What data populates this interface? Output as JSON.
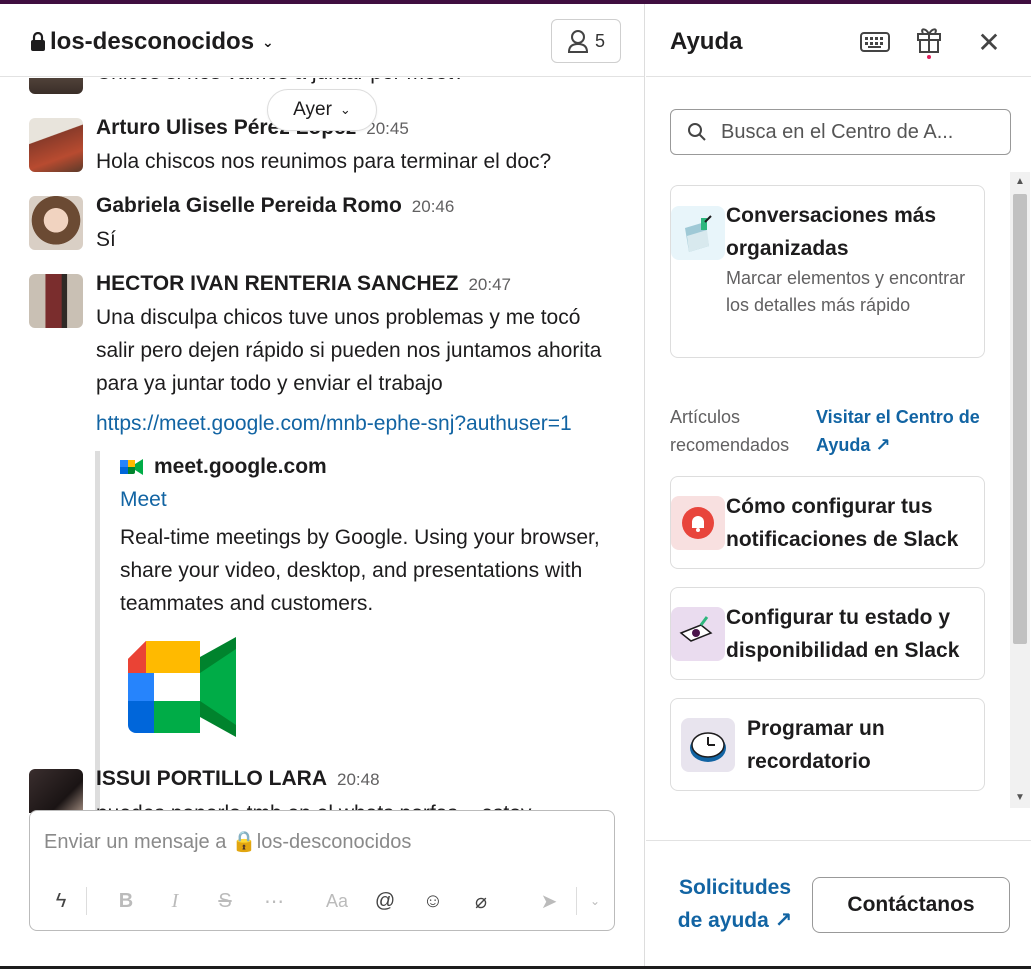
{
  "channel": {
    "name": "los-desconocidos",
    "member_count": "5",
    "day_divider": "Ayer"
  },
  "messages": [
    {
      "text": "Chicos si nos vamos a juntar por meet?"
    },
    {
      "author": "Arturo Ulises Pérez López",
      "time": "20:45",
      "text": "Hola chiscos nos reunimos para terminar el doc?"
    },
    {
      "author": "Gabriela Giselle Pereida Romo",
      "time": "20:46",
      "text": "Sí"
    },
    {
      "author": "HECTOR IVAN RENTERIA SANCHEZ",
      "time": "20:47",
      "text": "Una disculpa chicos tuve unos problemas y me tocó salir pero dejen rápido si pueden nos juntamos ahorita para ya juntar todo y enviar el trabajo",
      "link": "https://meet.google.com/mnb-ephe-snj?authuser=1",
      "unfurl": {
        "site": "meet.google.com",
        "title": "Meet",
        "description": "Real-time meetings by Google. Using your browser, share your video, desktop, and presentations with teammates and customers."
      }
    },
    {
      "author": "ISSUI PORTILLO LARA",
      "time": "20:48",
      "text": "puedes ponerlo tmb en el whats porfas... estoy"
    }
  ],
  "composer": {
    "placeholder": "Enviar un mensaje a 🔒los-desconocidos"
  },
  "help": {
    "title": "Ayuda",
    "search_placeholder": "Busca en el Centro de A...",
    "feature_card": {
      "title": "Conversaciones más organizadas",
      "subtitle": "Marcar elementos y encontrar los detalles más rápido"
    },
    "recommended_label": "Artículos recomendados",
    "visit_link": "Visitar el Centro de Ayuda ↗",
    "articles": [
      {
        "title": "Cómo configurar tus notificaciones de Slack"
      },
      {
        "title": "Configurar tu estado y disponibilidad en Slack"
      },
      {
        "title": "Programar un recordatorio"
      }
    ],
    "requests_link": "Solicitudes de ayuda ↗",
    "contact_button": "Contáctanos"
  },
  "colors": {
    "link": "#1264a3",
    "topbar": "#3f0e40"
  }
}
